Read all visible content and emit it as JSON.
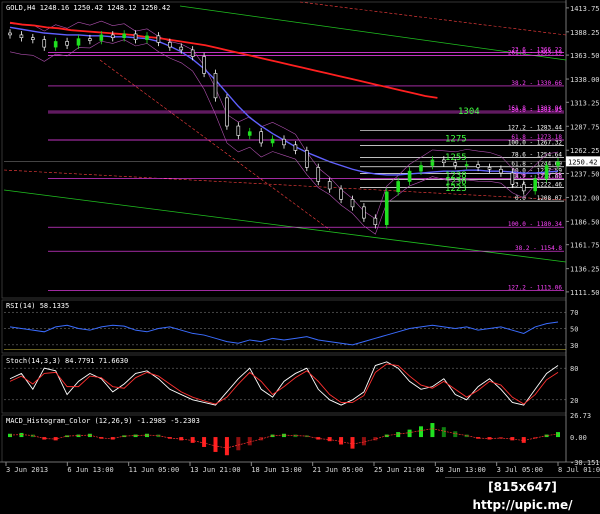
{
  "chart_data": [
    {
      "type": "candlestick",
      "symbol_header": "GOLD,H4  1248.16 1250.42 1248.12 1250.42",
      "price_axis_ticks": [
        "1413.75",
        "1388.25",
        "1363.50",
        "1338.00",
        "1313.25",
        "1287.75",
        "1262.25",
        "1237.50",
        "1212.00",
        "1186.50",
        "1161.75",
        "1136.25",
        "1111.50"
      ],
      "ylim": [
        1105,
        1420
      ],
      "current_price": "1250.42",
      "closes": [
        1385,
        1382,
        1380,
        1372,
        1378,
        1374,
        1381,
        1379,
        1385,
        1382,
        1386,
        1380,
        1384,
        1377,
        1372,
        1369,
        1362,
        1344,
        1318,
        1288,
        1278,
        1282,
        1270,
        1274,
        1268,
        1262,
        1244,
        1229,
        1221,
        1210,
        1202,
        1190,
        1183,
        1218,
        1229,
        1240,
        1246,
        1252,
        1249,
        1246,
        1247,
        1244,
        1242,
        1238,
        1226,
        1219,
        1232,
        1246,
        1250
      ],
      "moving_averages": [
        {
          "color": "#ff2020",
          "values": [
            1398,
            1396,
            1395,
            1393,
            1392,
            1390,
            1389,
            1388,
            1387,
            1386,
            1385,
            1383,
            1382,
            1380,
            1378,
            1376,
            1374,
            1371,
            1368,
            1365,
            1362,
            1359,
            1356,
            1353,
            1350,
            1347,
            1344,
            1341,
            1338,
            1335,
            1332,
            1329,
            1326,
            1323,
            1320,
            1318
          ]
        },
        {
          "color": "#6060ff",
          "values": [
            1393,
            1391,
            1389,
            1387,
            1386,
            1385,
            1385,
            1384,
            1384,
            1383,
            1383,
            1382,
            1381,
            1378,
            1373,
            1367,
            1359,
            1349,
            1337,
            1323,
            1309,
            1297,
            1288,
            1280,
            1273,
            1266,
            1260,
            1255,
            1250,
            1246,
            1242,
            1239,
            1237,
            1236,
            1236,
            1237,
            1238,
            1239,
            1240,
            1240,
            1241,
            1241,
            1240,
            1240,
            1239,
            1238,
            1238,
            1239,
            1240
          ]
        }
      ],
      "fib_levels": [
        {
          "label": "261.8 - 1363.19",
          "price": 1363.19,
          "color": "#ff44ff"
        },
        {
          "label": "23.6 - 1366.22",
          "price": 1366.22,
          "color": "#ff44ff"
        },
        {
          "label": "38.2 - 1330.66",
          "price": 1330.66,
          "color": "#ff44ff"
        },
        {
          "label": "161.8 - 1303.94",
          "price": 1303.94,
          "color": "#ff44ff"
        },
        {
          "label": "50.0 - 1301.93",
          "price": 1301.93,
          "color": "#ff44ff"
        },
        {
          "label": "127.2 - 1283.44",
          "price": 1283.44,
          "color": "#ffffff"
        },
        {
          "label": "61.8 - 1273.18",
          "price": 1273.18,
          "color": "#ff44ff"
        },
        {
          "label": "100.0 - 1267.32",
          "price": 1267.32,
          "color": "#ffffff"
        },
        {
          "label": "78.6 - 1254.64",
          "price": 1254.64,
          "color": "#ffffff"
        },
        {
          "label": "61.8 - 1244.69",
          "price": 1244.69,
          "color": "#ffffff"
        },
        {
          "label": "50.0 - 1237.59",
          "price": 1237.59,
          "color": "#ffffff"
        },
        {
          "label": "38.2 - 1231.00",
          "price": 1231.0,
          "color": "#ffffff"
        },
        {
          "label": "78.6 - 1232.36",
          "price": 1232.36,
          "color": "#ff44ff"
        },
        {
          "label": "23.6 - 1222.46",
          "price": 1222.46,
          "color": "#ffffff"
        },
        {
          "label": "0.0 - 1208.07",
          "price": 1208.07,
          "color": "#ffffff"
        },
        {
          "label": "100.0 - 1180.34",
          "price": 1180.34,
          "color": "#ff44ff"
        },
        {
          "label": "38.2 - 1154.8",
          "price": 1154.8,
          "color": "#ff44ff"
        },
        {
          "label": "127.2 - 1113.06",
          "price": 1113.06,
          "color": "#ff44ff"
        }
      ],
      "green_labels": [
        {
          "text": "1304",
          "price": 1304
        },
        {
          "text": "1275",
          "price": 1275
        },
        {
          "text": "1255",
          "price": 1255
        },
        {
          "text": "1238",
          "price": 1236
        },
        {
          "text": "1230",
          "price": 1229
        },
        {
          "text": "1223",
          "price": 1222
        }
      ]
    },
    {
      "type": "line",
      "title": "RSI(14) 58.1335",
      "ticks": [
        "70",
        "50",
        "30"
      ],
      "ylim": [
        20,
        85
      ],
      "values": [
        52,
        50,
        48,
        46,
        52,
        54,
        50,
        48,
        52,
        54,
        53,
        48,
        46,
        50,
        52,
        48,
        44,
        42,
        38,
        34,
        32,
        36,
        34,
        38,
        36,
        38,
        40,
        36,
        34,
        32,
        30,
        34,
        38,
        42,
        46,
        50,
        52,
        54,
        52,
        50,
        52,
        48,
        50,
        52,
        48,
        44,
        52,
        56,
        58
      ]
    },
    {
      "type": "line",
      "title": "Stoch(14,3,3) 84.7791 71.6630",
      "ticks": [
        "80",
        "20"
      ],
      "ylim": [
        -5,
        105
      ],
      "series": [
        {
          "color": "#ffffff",
          "values": [
            60,
            70,
            40,
            80,
            75,
            30,
            55,
            70,
            60,
            35,
            50,
            70,
            75,
            60,
            40,
            30,
            20,
            15,
            10,
            35,
            60,
            80,
            40,
            25,
            55,
            70,
            80,
            40,
            20,
            10,
            20,
            35,
            85,
            92,
            80,
            55,
            40,
            45,
            60,
            30,
            20,
            45,
            60,
            40,
            15,
            10,
            40,
            70,
            85
          ]
        },
        {
          "color": "#ff3030",
          "values": [
            55,
            65,
            50,
            70,
            72,
            45,
            45,
            65,
            62,
            45,
            42,
            62,
            72,
            65,
            50,
            35,
            25,
            18,
            12,
            25,
            50,
            72,
            55,
            30,
            45,
            62,
            75,
            55,
            30,
            15,
            15,
            28,
            72,
            88,
            85,
            65,
            48,
            42,
            55,
            40,
            25,
            38,
            55,
            48,
            25,
            12,
            30,
            58,
            72
          ]
        }
      ]
    },
    {
      "type": "bar",
      "title": "MACD_Histogram_Color (12,26,9) -1.2985 -5.2303",
      "ticks": [
        "26.73",
        "0.00",
        "-30.1515"
      ],
      "ylim": [
        -30.2,
        26.73
      ],
      "values": [
        4,
        5,
        3,
        -3,
        -4,
        2,
        3,
        4,
        -2,
        -3,
        2,
        3,
        4,
        3,
        -2,
        -4,
        -7,
        -12,
        -18,
        -22,
        -16,
        -10,
        -4,
        3,
        4,
        3,
        2,
        -3,
        -5,
        -9,
        -14,
        -10,
        -4,
        3,
        6,
        9,
        13,
        17,
        12,
        7,
        3,
        -2,
        -3,
        -2,
        -4,
        -7,
        -2,
        3,
        6
      ],
      "colors": {
        "rising_positive": "#20e020",
        "falling_positive": "#108010",
        "falling_negative": "#ff2020",
        "rising_negative": "#901010"
      }
    }
  ],
  "time_axis": [
    "3 Jun 2013",
    "6 Jun 13:00",
    "11 Jun 05:00",
    "13 Jun 21:00",
    "18 Jun 13:00",
    "21 Jun 05:00",
    "25 Jun 21:00",
    "28 Jun 13:00",
    "3 Jul 05:00",
    "8 Jul 01:00"
  ],
  "watermark": "[815x647] http://upic.me/",
  "colors": {
    "bull": "#20e020",
    "bear": "#ffffff",
    "grid": "#303030",
    "separator": "#808080"
  }
}
